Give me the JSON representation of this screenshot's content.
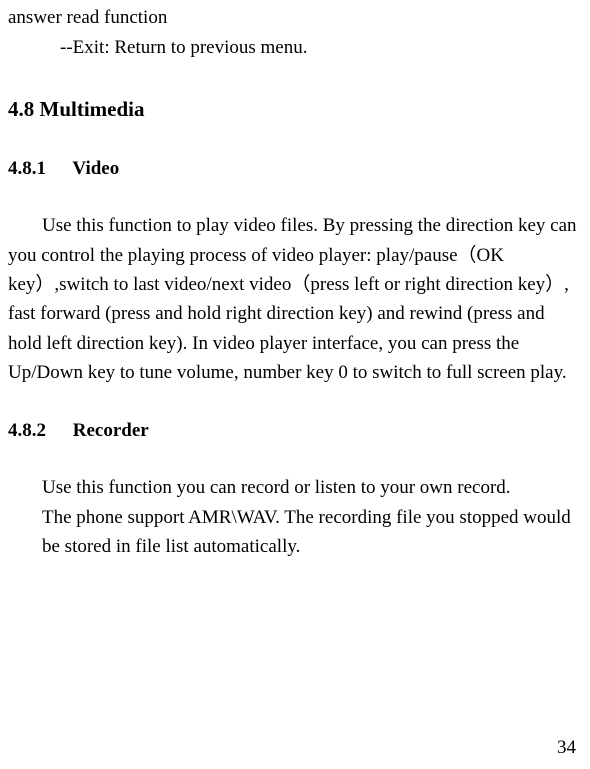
{
  "frag": {
    "line1": "answer read function",
    "line2": "--Exit: Return to previous menu."
  },
  "section": {
    "number": "4.8",
    "title": "Multimedia"
  },
  "sub1": {
    "number": "4.8.1",
    "title": "Video",
    "body": "Use this function to play video files. By pressing the direction key can you control the playing process of video player: play/pause（OK key）,switch to last video/next video（press left or right direction key）, fast forward (press and hold right direction key) and rewind (press and hold left direction key). In video player interface, you can press the Up/Down key to tune volume, number key 0 to switch to full screen play."
  },
  "sub2": {
    "number": "4.8.2",
    "title": "Recorder",
    "body1": "Use this function you can record or listen to your own record.",
    "body2": "The phone support AMR\\WAV. The recording file you stopped would be stored in file list automatically."
  },
  "page_number": "34"
}
